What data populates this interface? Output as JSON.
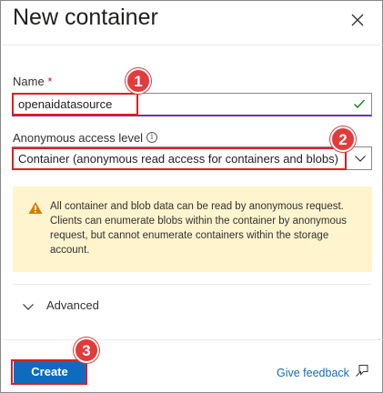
{
  "panel": {
    "title": "New container",
    "close_icon": "close-icon"
  },
  "name_field": {
    "label": "Name",
    "required_marker": "*",
    "value": "openaidatasource",
    "status_icon": "check-icon"
  },
  "access_level": {
    "label": "Anonymous access level",
    "info_icon": "info-icon",
    "info_glyph": "i",
    "selected": "Container (anonymous read access for containers and blobs)",
    "chevron_icon": "chevron-down-icon"
  },
  "warning": {
    "icon": "warning-icon",
    "text": "All container and blob data can be read by anonymous request. Clients can enumerate blobs within the container by anonymous request, but cannot enumerate containers within the storage account."
  },
  "advanced": {
    "label": "Advanced",
    "icon": "chevron-down-icon"
  },
  "footer": {
    "create_label": "Create",
    "feedback_label": "Give feedback",
    "feedback_icon": "feedback-icon"
  },
  "annotations": {
    "step1": "1",
    "step2": "2",
    "step3": "3"
  },
  "colors": {
    "primary": "#0f6cbd",
    "annotation_red": "#e01e1e",
    "warning_bg": "#fff4ce",
    "success_green": "#107c10",
    "warning_orange": "#d47f00"
  }
}
